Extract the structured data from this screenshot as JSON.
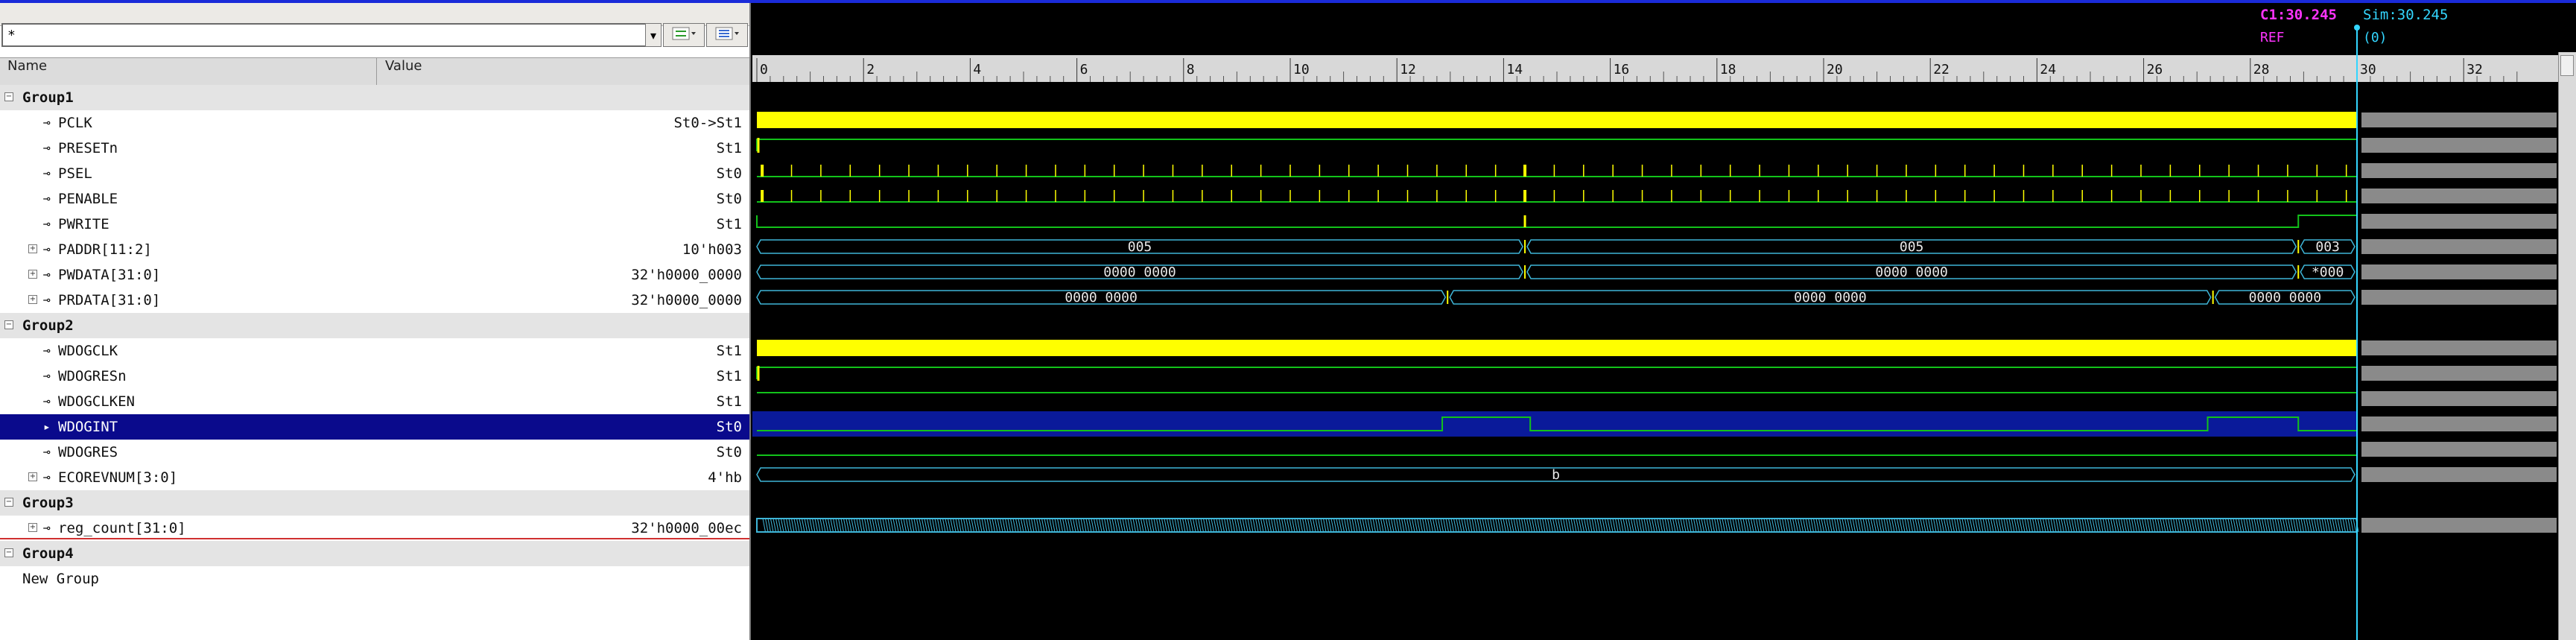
{
  "filter": {
    "value": "*"
  },
  "toolbar": {
    "dropdown_glyph": "▾"
  },
  "header": {
    "name_label": "Name",
    "value_label": "Value"
  },
  "cursor": {
    "c1_label": "C1:30.245",
    "sim_label": "Sim:30.245",
    "ref_label": "REF",
    "delta_label": "(0)"
  },
  "timeline": {
    "ticks": [
      "0",
      "2",
      "4",
      "6",
      "8",
      "10",
      "12",
      "14",
      "16",
      "18",
      "20",
      "22",
      "24",
      "26",
      "28",
      "30",
      "32"
    ]
  },
  "tree": [
    {
      "kind": "group",
      "label": "Group1"
    },
    {
      "kind": "signal",
      "label": "PCLK",
      "value": "St0->St1"
    },
    {
      "kind": "signal",
      "label": "PRESETn",
      "value": "St1"
    },
    {
      "kind": "signal",
      "label": "PSEL",
      "value": "St0"
    },
    {
      "kind": "signal",
      "label": "PENABLE",
      "value": "St0"
    },
    {
      "kind": "signal",
      "label": "PWRITE",
      "value": "St1"
    },
    {
      "kind": "bus",
      "label": "PADDR[11:2]",
      "value": "10'h003"
    },
    {
      "kind": "bus",
      "label": "PWDATA[31:0]",
      "value": "32'h0000_0000"
    },
    {
      "kind": "bus",
      "label": "PRDATA[31:0]",
      "value": "32'h0000_0000"
    },
    {
      "kind": "group",
      "label": "Group2"
    },
    {
      "kind": "signal",
      "label": "WDOGCLK",
      "value": "St1"
    },
    {
      "kind": "signal",
      "label": "WDOGRESn",
      "value": "St1"
    },
    {
      "kind": "signal",
      "label": "WDOGCLKEN",
      "value": "St1"
    },
    {
      "kind": "signal",
      "label": "WDOGINT",
      "value": "St0",
      "selected": true
    },
    {
      "kind": "signal",
      "label": "WDOGRES",
      "value": "St0"
    },
    {
      "kind": "bus",
      "label": "ECOREVNUM[3:0]",
      "value": "4'hb"
    },
    {
      "kind": "group",
      "label": "Group3"
    },
    {
      "kind": "bus",
      "label": "reg_count[31:0]",
      "value": "32'h0000_00ec"
    },
    {
      "kind": "group",
      "label": "Group4"
    },
    {
      "kind": "newgroup",
      "label": "New Group"
    }
  ],
  "bus_values": {
    "paddr": [
      "005",
      "005",
      "003"
    ],
    "pwdata": [
      "0000 0000",
      "0000 0000",
      "*000"
    ],
    "prdata": [
      "0000 0000",
      "0000 0000",
      "0000 0000"
    ],
    "ecorevnum": [
      "b"
    ]
  },
  "colors": {
    "clock": "#ffff00",
    "signal": "#12c21a",
    "bus": "#3fb6d8",
    "cursor": "#33d6ff",
    "selected_row": "#0a0a8c",
    "c1": "#ff33ff",
    "sim": "#33d6ff"
  }
}
